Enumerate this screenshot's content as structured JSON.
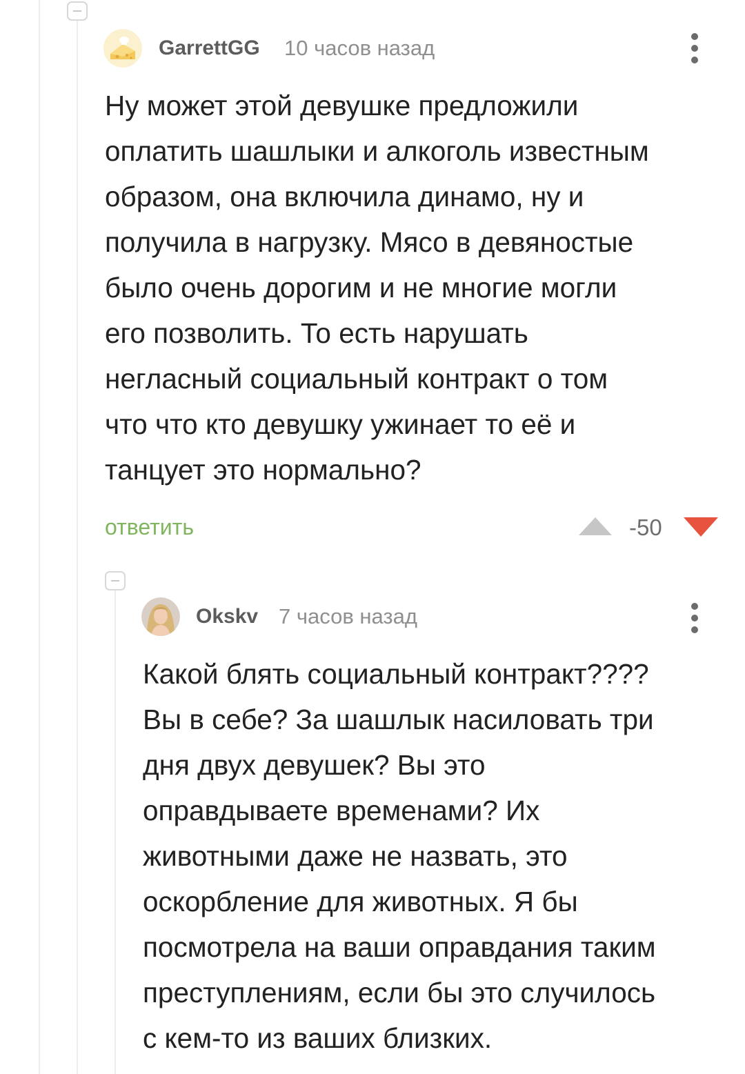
{
  "comments": [
    {
      "username": "GarrettGG",
      "timestamp": "10 часов назад",
      "avatar_icon": "cheese-avatar-icon",
      "text": "Ну может этой девушке предложили\nоплатить шашлыки и алкоголь известным\nобразом, она включила динамо, ну и\nполучила в нагрузку. Мясо в девяностые\nбыло очень дорогим и не многие могли\nего позволить. То есть нарушать\nнегласный социальный контракт о том\nчто что кто девушку ужинает то её и\nтанцует это нормально?",
      "reply_label": "ответить",
      "rating": "-50",
      "downvoted": true
    },
    {
      "username": "Okskv",
      "timestamp": "7 часов назад",
      "avatar_icon": "user-photo-avatar-icon",
      "text": "Какой блять социальный контракт????\nВы в себе? За шашлык насиловать три\nдня двух девушек? Вы это\nоправдываете временами? Их\nживотными даже не назвать, это\nоскорбление для животных. Я бы\nпосмотрела на ваши оправдания таким\nпреступлениям, если бы это случилось\nс кем-то из ваших близких."
    }
  ],
  "colors": {
    "accent_green": "#7fb55c",
    "downvote_red": "#e8533f",
    "upvote_grey": "#c6c6c6",
    "thread_line": "#ececec"
  }
}
